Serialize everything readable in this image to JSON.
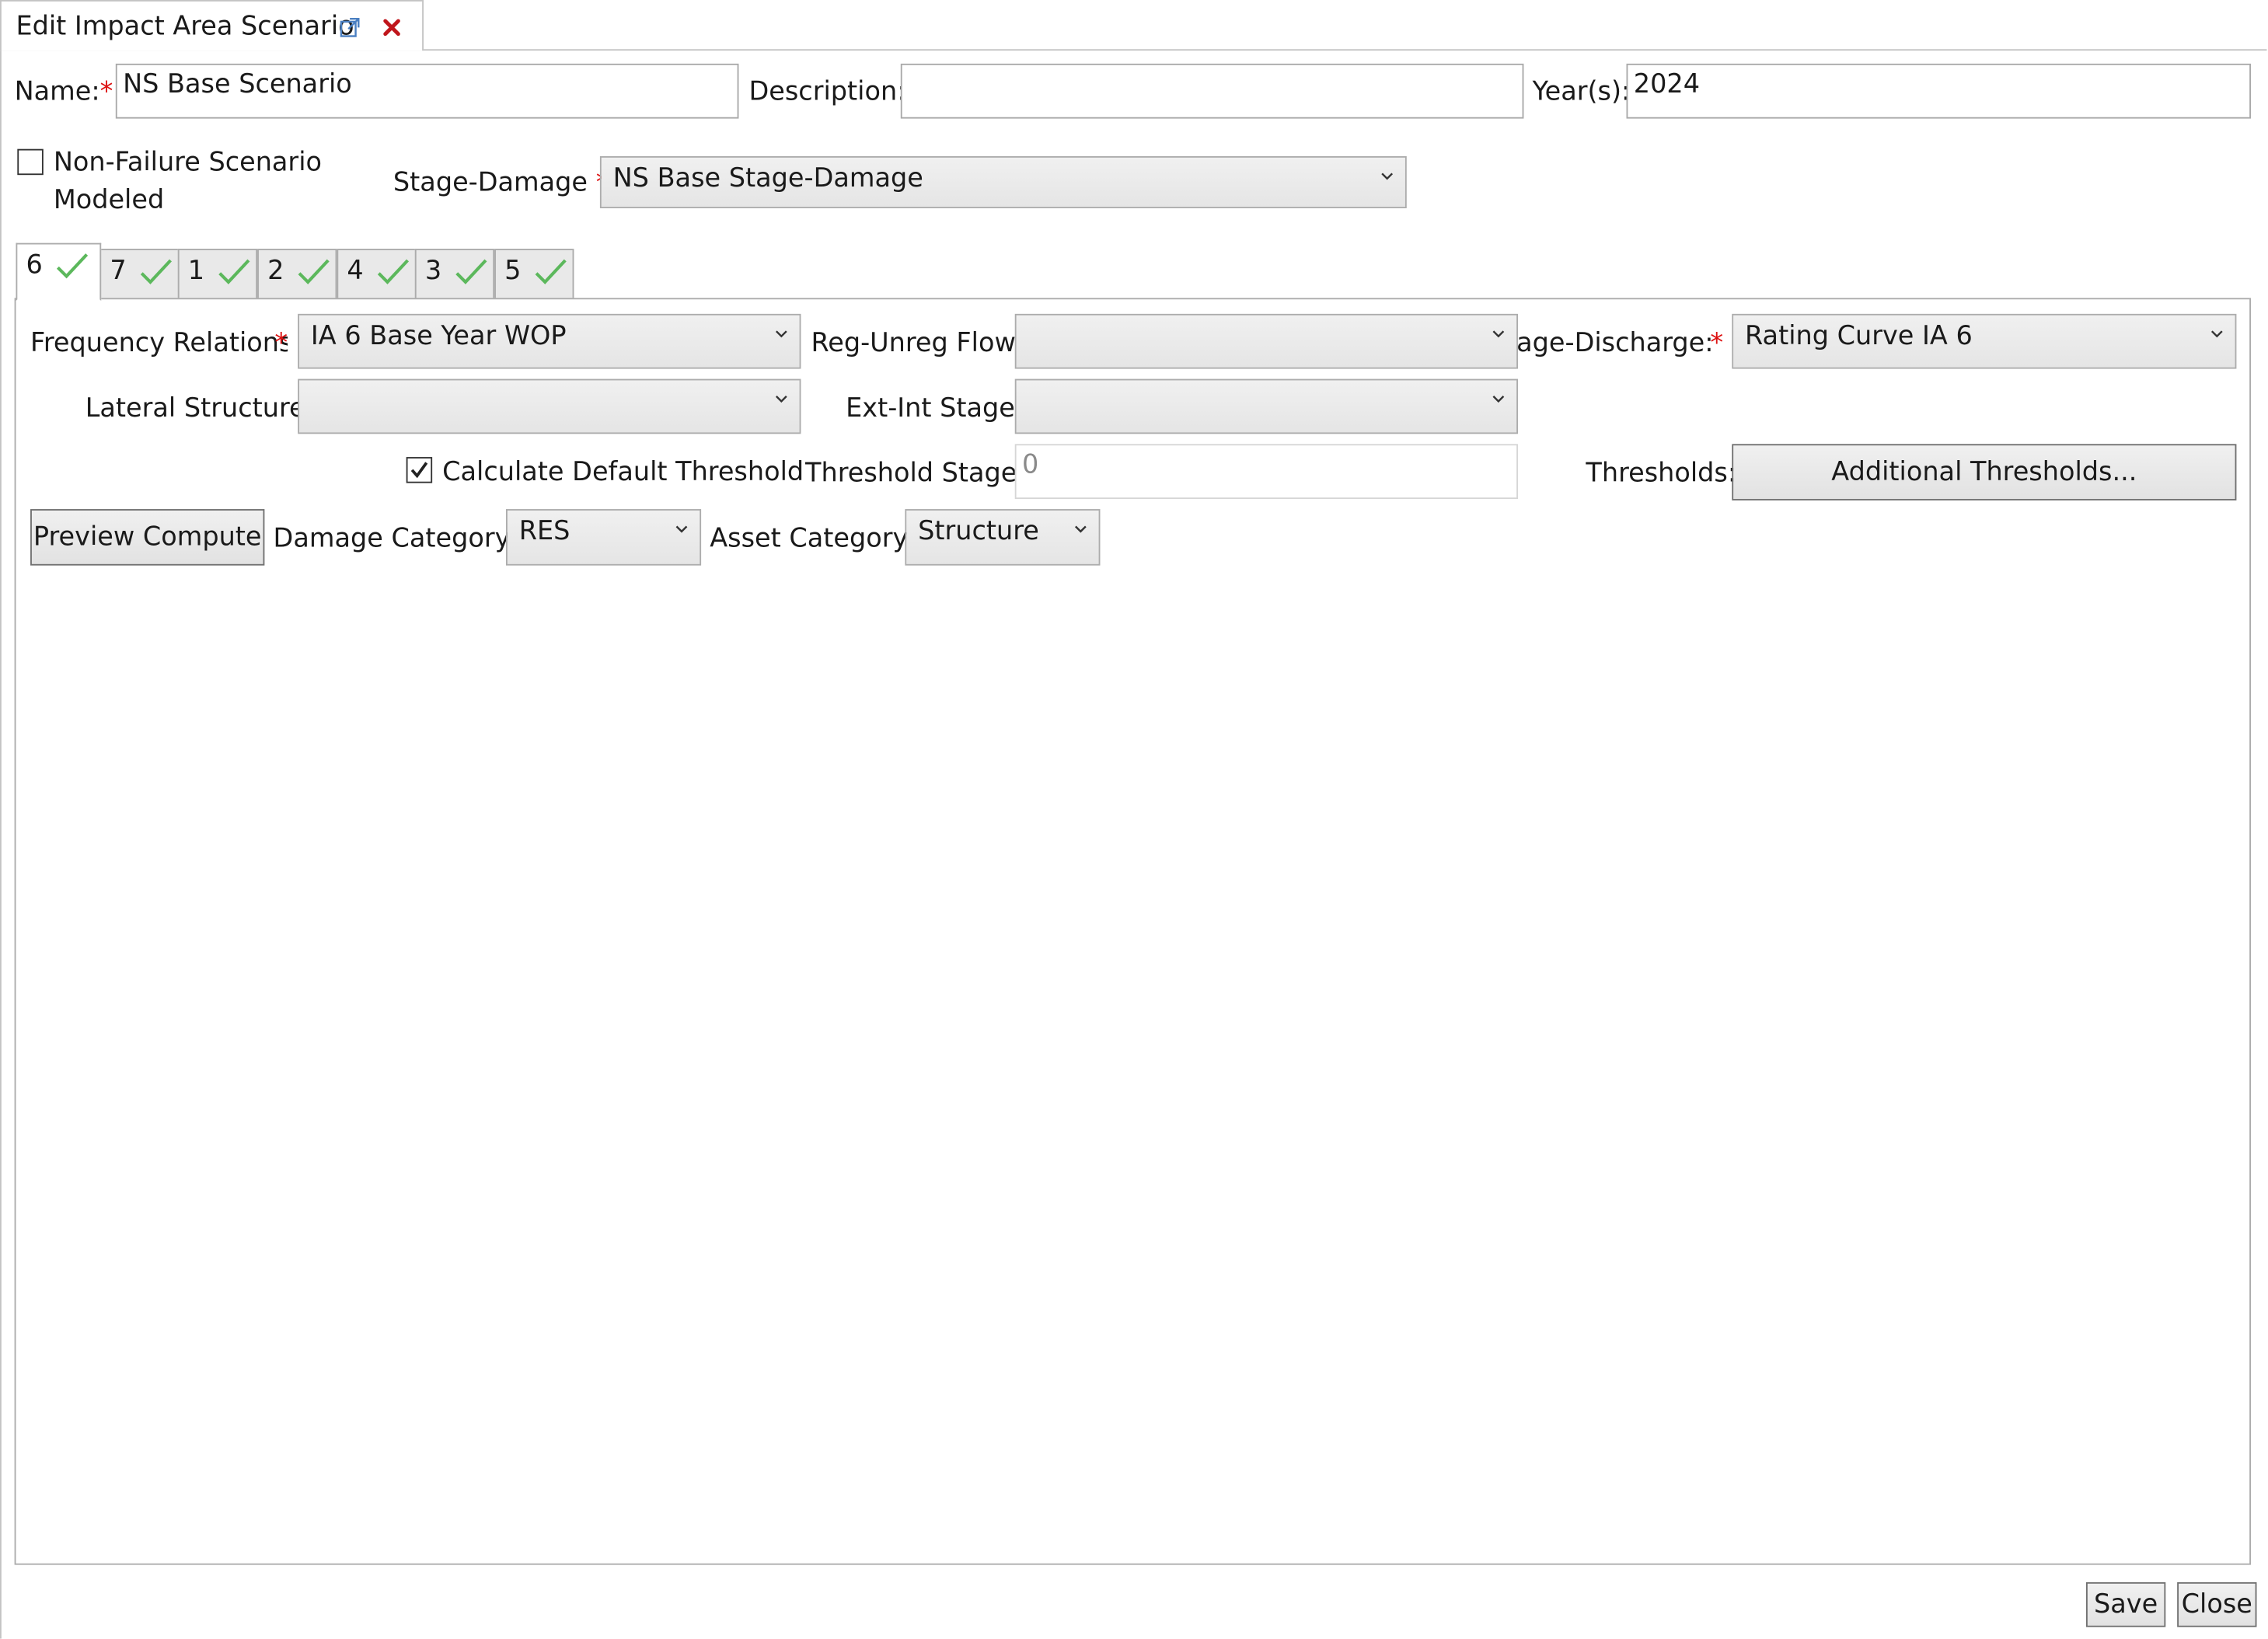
{
  "window": {
    "tab_title": "Edit Impact Area Scenario",
    "popout_icon": "external-link-icon",
    "close_icon": "close-x-icon"
  },
  "header": {
    "name_label": "Name:",
    "name_value": "NS Base Scenario",
    "description_label": "Description:",
    "description_value": "",
    "years_label": "Year(s):",
    "years_value": "2024",
    "non_failure_label_line1": "Non-Failure Scenario",
    "non_failure_label_line2": "Modeled",
    "non_failure_checked": false,
    "stage_damage_label": "Stage-Damage",
    "stage_damage_value": "NS Base Stage-Damage"
  },
  "required_marker": "*",
  "impact_area_tabs": [
    {
      "label": "6",
      "status_icon": "check-icon",
      "active": true
    },
    {
      "label": "7",
      "status_icon": "check-icon",
      "active": false
    },
    {
      "label": "1",
      "status_icon": "check-icon",
      "active": false
    },
    {
      "label": "2",
      "status_icon": "check-icon",
      "active": false
    },
    {
      "label": "4",
      "status_icon": "check-icon",
      "active": false
    },
    {
      "label": "3",
      "status_icon": "check-icon",
      "active": false
    },
    {
      "label": "5",
      "status_icon": "check-icon",
      "active": false
    }
  ],
  "panel": {
    "frequency_label": "Frequency Relations",
    "frequency_value": "IA 6 Base Year WOP",
    "reg_unreg_label": "Reg-Unreg Flow",
    "reg_unreg_value": "",
    "stage_discharge_label": "age-Discharge:",
    "stage_discharge_value": "Rating Curve IA 6",
    "lateral_label": "Lateral Structure:",
    "lateral_value": "",
    "ext_int_label": "Ext-Int Stage:",
    "ext_int_value": "",
    "calc_default_label": "Calculate Default Threshold",
    "calc_default_checked": true,
    "threshold_stage_label": "Threshold Stage:",
    "threshold_stage_value": "0",
    "thresholds_label": "Thresholds:",
    "additional_thresholds_button": "Additional Thresholds...",
    "preview_compute_button": "Preview Compute",
    "damage_category_label": "Damage Category:",
    "damage_category_value": "RES",
    "asset_category_label": "Asset Category:",
    "asset_category_value": "Structure"
  },
  "footer": {
    "save_button": "Save",
    "close_button": "Close"
  },
  "colors": {
    "check_green": "#5cb85c",
    "required_red": "#dd1111",
    "close_red": "#c0161c",
    "popout_blue": "#4a7fc1"
  }
}
